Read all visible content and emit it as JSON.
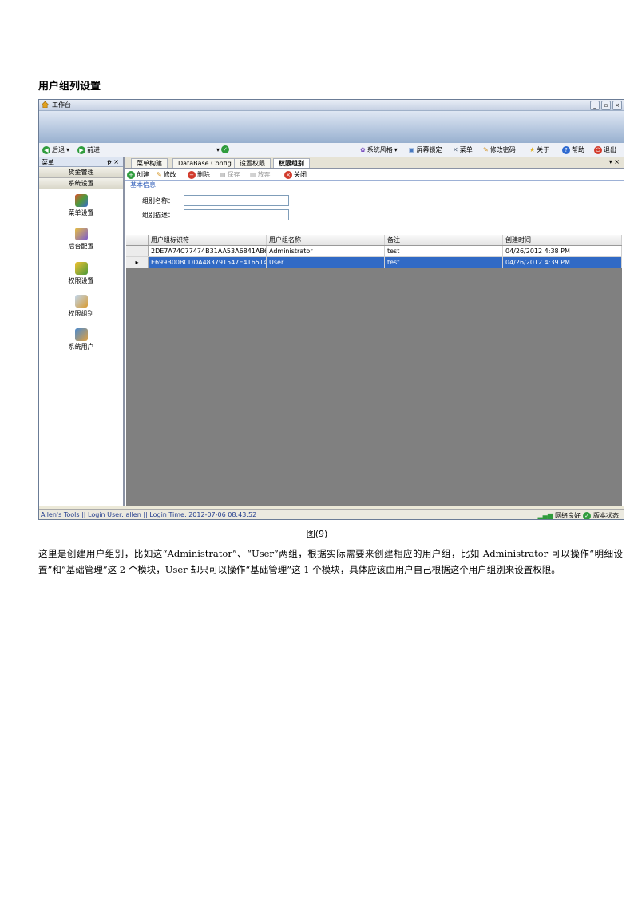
{
  "section_heading": "用户组列设置",
  "window": {
    "title": "工作台",
    "controls": [
      "_",
      "▫",
      "×"
    ]
  },
  "toolbar": {
    "back": "后退",
    "forward": "前进",
    "items": [
      "系统风格",
      "屏幕锁定",
      "菜单",
      "修改密码",
      "关于",
      "帮助",
      "退出"
    ]
  },
  "sidebar": {
    "title": "菜单",
    "pin": "ᵽ ×",
    "groups": [
      "货金管理",
      "系统设置"
    ],
    "items": [
      "菜单设置",
      "后台配置",
      "权限设置",
      "权限组别",
      "系统用户"
    ]
  },
  "tabs": {
    "items": [
      "菜单构建",
      "DataBase Config",
      "设置权限",
      "权限组别"
    ],
    "active": 3,
    "right": "▾ ×"
  },
  "actions": [
    "创建",
    "修改",
    "删除",
    "保存",
    "放弃",
    "关闭"
  ],
  "form": {
    "group_title": "基本信息",
    "name_label": "组别名称：",
    "desc_label": "组别描述："
  },
  "grid": {
    "columns": [
      "用户组标识符",
      "用户组名称",
      "备注",
      "创建时间"
    ],
    "rows": [
      [
        "2DE7A74C77474B31AA53A6841AB66...",
        "Administrator",
        "test",
        "04/26/2012 4:38 PM"
      ],
      [
        "E699B00BCDDA483791547E41651429...",
        "User",
        "test",
        "04/26/2012 4:39 PM"
      ]
    ],
    "selected_row": 1
  },
  "status": {
    "left": "Allen's Tools  ||  Login User: allen  ||  Login Time: 2012-07-06 08:43:52",
    "network": "网络良好",
    "version": "版本状态"
  },
  "caption": "图(9)",
  "paragraph": "这里是创建用户组别，比如这“Administrator”、“User”两组，根据实际需要来创建相应的用户组，比如 Administrator 可以操作“明细设置”和“基础管理”这 2 个模块，User 却只可以操作“基础管理”这 1 个模块，具体应该由用户自己根据这个用户组别来设置权限。"
}
